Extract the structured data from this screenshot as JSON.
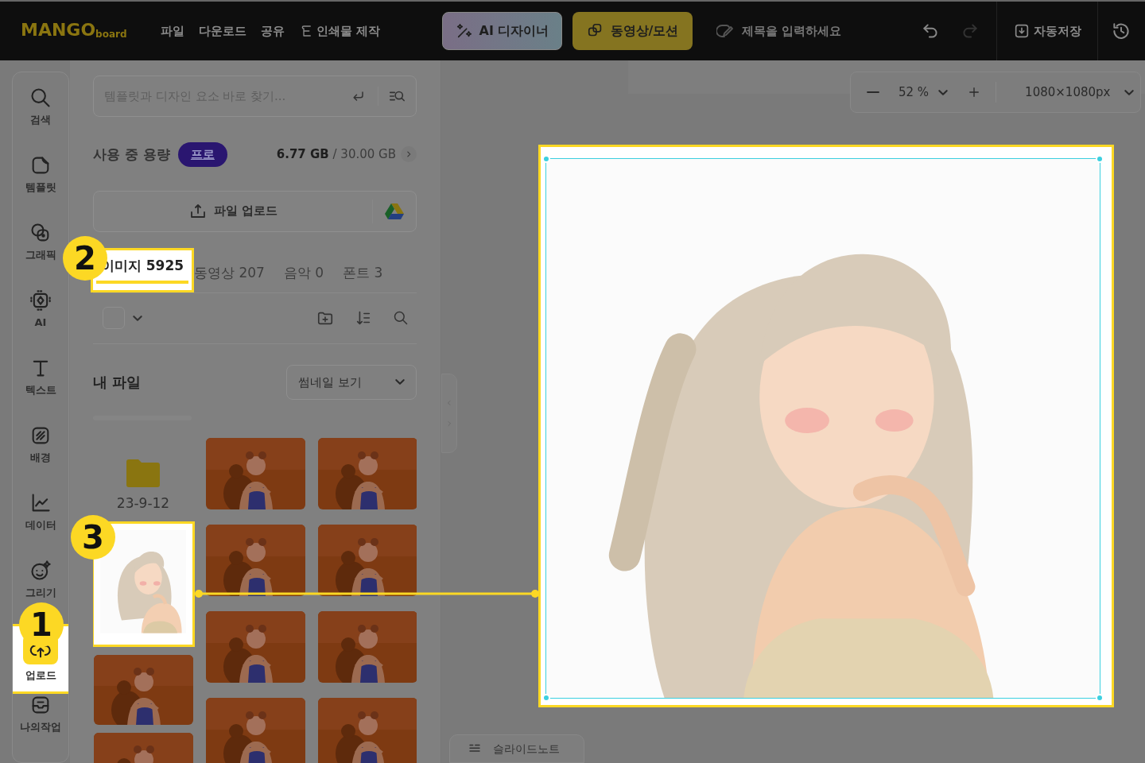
{
  "header": {
    "logo_main": "MANGO",
    "logo_sub": "board",
    "menu": [
      "파일",
      "다운로드",
      "공유",
      "인쇄물 제작"
    ],
    "ai_button": "AI 디자이너",
    "motion_button": "동영상/모션",
    "title_placeholder": "제목을 입력하세요",
    "autosave": "자동저장"
  },
  "rail": [
    {
      "label": "검색",
      "kind": "search",
      "selected": false
    },
    {
      "label": "템플릿",
      "kind": "template",
      "selected": false
    },
    {
      "label": "그래픽",
      "kind": "graphic",
      "selected": false
    },
    {
      "label": "AI",
      "kind": "ai",
      "selected": false
    },
    {
      "label": "텍스트",
      "kind": "text",
      "selected": false
    },
    {
      "label": "배경",
      "kind": "background",
      "selected": false
    },
    {
      "label": "데이터",
      "kind": "data",
      "selected": false
    },
    {
      "label": "그리기",
      "kind": "draw",
      "selected": false
    },
    {
      "label": "업로드",
      "kind": "upload",
      "selected": true,
      "callout": "1"
    },
    {
      "label": "나의작업",
      "kind": "work",
      "selected": false
    }
  ],
  "panel": {
    "search_placeholder": "템플릿과 디자인 요소 바로 찾기...",
    "storage": {
      "label": "사용 중 용량",
      "badge": "프로",
      "used": "6.77 GB",
      "total": "/ 30.00 GB"
    },
    "upload_button": "파일 업로드",
    "tabs": [
      {
        "label": "이미지 5925",
        "selected": true,
        "callout": "2"
      },
      {
        "label": "동영상 207",
        "selected": false
      },
      {
        "label": "음악 0",
        "selected": false
      },
      {
        "label": "폰트 3",
        "selected": false
      }
    ],
    "select_all_checked": false,
    "my_files": "내 파일",
    "view_select": "썸네일 보기",
    "folder": "23-9-12",
    "left_thumbs": [
      {
        "kind": "portrait",
        "callout": "3"
      },
      {
        "kind": "orange"
      },
      {
        "kind": "orange"
      }
    ],
    "grid_thumbs": [
      {
        "kind": "orange"
      },
      {
        "kind": "orange"
      },
      {
        "kind": "orange"
      },
      {
        "kind": "orange"
      },
      {
        "kind": "orange"
      },
      {
        "kind": "orange"
      },
      {
        "kind": "orange"
      },
      {
        "kind": "orange"
      }
    ]
  },
  "canvas": {
    "zoom": "52 %",
    "size": "1080×1080px",
    "slide_notes": "슬라이드노트"
  }
}
